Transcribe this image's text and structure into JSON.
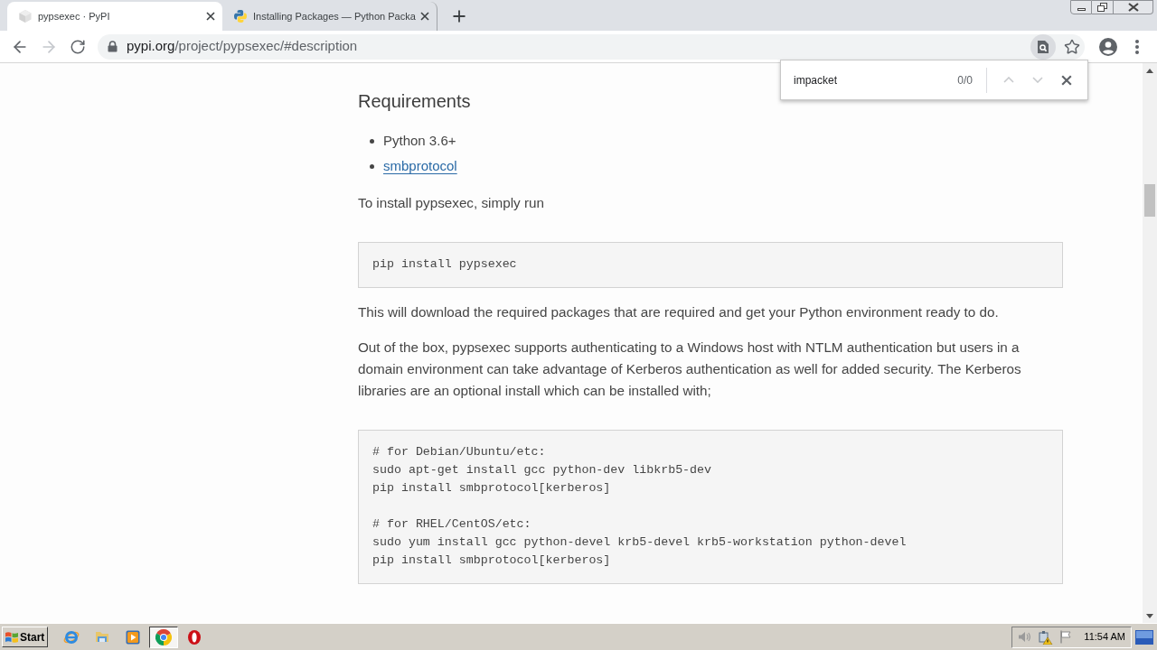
{
  "browser": {
    "tabs": [
      {
        "kind": "cube",
        "title": "pypsexec · PyPI",
        "selected": true
      },
      {
        "kind": "python",
        "title": "Installing Packages — Python Packa",
        "selected": false
      }
    ],
    "nav": [
      {
        "kind": "back",
        "disabled": false
      },
      {
        "kind": "forward",
        "disabled": true
      },
      {
        "kind": "reload",
        "disabled": false
      }
    ],
    "address": {
      "host": "pypi.org",
      "path": "/project/pypsexec/#description"
    },
    "find_bar": {
      "value": "impacket",
      "count": "0/0",
      "buttons": [
        {
          "kind": "up",
          "disabled": true
        },
        {
          "kind": "down",
          "disabled": true
        },
        {
          "kind": "close",
          "disabled": false
        }
      ]
    }
  },
  "content": [
    {
      "kind": "heading",
      "text": "Requirements"
    },
    {
      "kind": "list",
      "items": [
        {
          "kind": "text",
          "text": "Python 3.6+"
        },
        {
          "kind": "link",
          "text": "smbprotocol"
        }
      ]
    },
    {
      "kind": "paragraph",
      "text": "To install pypsexec, simply run"
    },
    {
      "kind": "code",
      "text": "pip install pypsexec"
    },
    {
      "kind": "paragraph",
      "text": "This will download the required packages that are required and get your Python environment ready to do."
    },
    {
      "kind": "paragraph",
      "text": "Out of the box, pypsexec supports authenticating to a Windows host with NTLM authentication but users in a domain environment can take advantage of Kerberos authentication as well for added security. The Kerberos libraries are an optional install which can be installed with;"
    },
    {
      "kind": "code",
      "text": "# for Debian/Ubuntu/etc:\nsudo apt-get install gcc python-dev libkrb5-dev\npip install smbprotocol[kerberos]\n\n# for RHEL/CentOS/etc:\nsudo yum install gcc python-devel krb5-devel krb5-workstation python-devel\npip install smbprotocol[kerberos]"
    }
  ],
  "taskbar": {
    "start": "Start",
    "apps": [
      {
        "kind": "e",
        "selected": false
      },
      {
        "kind": "folder",
        "selected": false
      },
      {
        "kind": "media",
        "selected": false
      },
      {
        "kind": "chrome",
        "selected": true
      },
      {
        "kind": "opera",
        "selected": false
      }
    ],
    "time": "11:54 AM"
  }
}
